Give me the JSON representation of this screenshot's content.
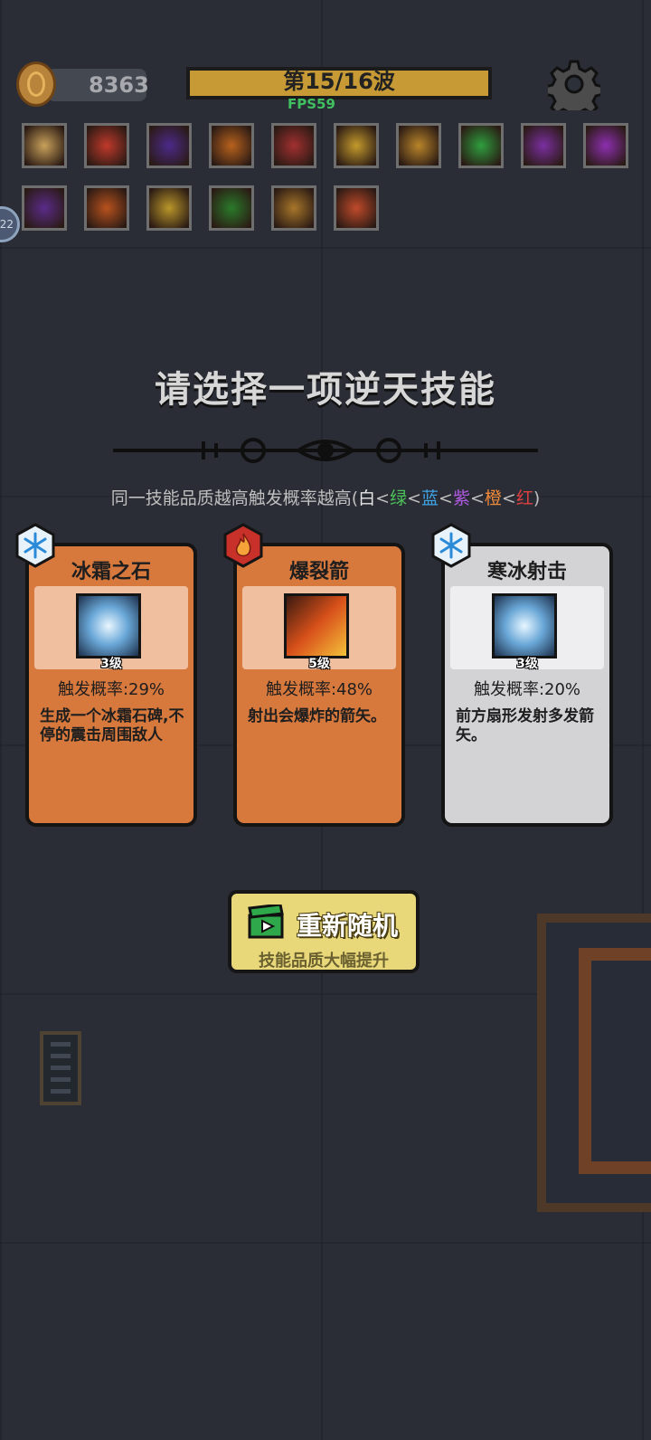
{
  "hud": {
    "coins": "8363",
    "wave": "第15/16波",
    "fps": "FPS59",
    "side_badge": "22"
  },
  "owned_skills": [
    {
      "icon": "lightning-burst-icon",
      "color": "#c9a15a"
    },
    {
      "icon": "flame-swirl-icon",
      "color": "#c0392b"
    },
    {
      "icon": "void-vortex-icon",
      "color": "#4b2a8a"
    },
    {
      "icon": "fire-rain-icon",
      "color": "#b8621d"
    },
    {
      "icon": "blood-cross-icon",
      "color": "#a13030"
    },
    {
      "icon": "golden-fist-icon",
      "color": "#c49a2c"
    },
    {
      "icon": "golden-shield-icon",
      "color": "#b9852a"
    },
    {
      "icon": "poison-cloud-icon",
      "color": "#2e9e3e"
    },
    {
      "icon": "shadow-splash-icon",
      "color": "#7a2fa0"
    },
    {
      "icon": "purple-claw-icon",
      "color": "#8d2fb0"
    },
    {
      "icon": "violet-slash-icon",
      "color": "#5a2b8a"
    },
    {
      "icon": "fire-orb-icon",
      "color": "#b8521d"
    },
    {
      "icon": "golden-beetle-icon",
      "color": "#b9962a"
    },
    {
      "icon": "green-spikes-icon",
      "color": "#2a7a2a"
    },
    {
      "icon": "golden-bolt-icon",
      "color": "#a8762a"
    },
    {
      "icon": "mushroom-icon",
      "color": "#c04a2a"
    }
  ],
  "prompt": {
    "title": "请选择一项逆天技能",
    "hint_prefix": "同一技能品质越高触发概率越高(",
    "qualities": [
      {
        "label": "白",
        "color": "#e6e6e6"
      },
      {
        "label": "绿",
        "color": "#4cc35a"
      },
      {
        "label": "蓝",
        "color": "#3fa4e6"
      },
      {
        "label": "紫",
        "color": "#b05ae0"
      },
      {
        "label": "橙",
        "color": "#f08a3a"
      },
      {
        "label": "红",
        "color": "#e04040"
      }
    ],
    "separator": "<",
    "hint_suffix": ")"
  },
  "cards": [
    {
      "name": "冰霜之石",
      "level": "3级",
      "rate": "触发概率:29%",
      "desc": "生成一个冰霜石碑,不停的震击周围敌人",
      "quality": "orange",
      "element": "snowflake-icon",
      "art": "frost-stone-art-icon"
    },
    {
      "name": "爆裂箭",
      "level": "5级",
      "rate": "触发概率:48%",
      "desc": "射出会爆炸的箭矢。",
      "quality": "orange",
      "element": "fire-icon",
      "art": "explosive-arrow-art-icon"
    },
    {
      "name": "寒冰射击",
      "level": "3级",
      "rate": "触发概率:20%",
      "desc": "前方扇形发射多发箭矢。",
      "quality": "white",
      "element": "snowflake-icon",
      "art": "ice-shot-art-icon"
    }
  ],
  "reroll": {
    "title": "重新随机",
    "subtitle": "技能品质大幅提升",
    "icon": "clapperboard-icon"
  }
}
